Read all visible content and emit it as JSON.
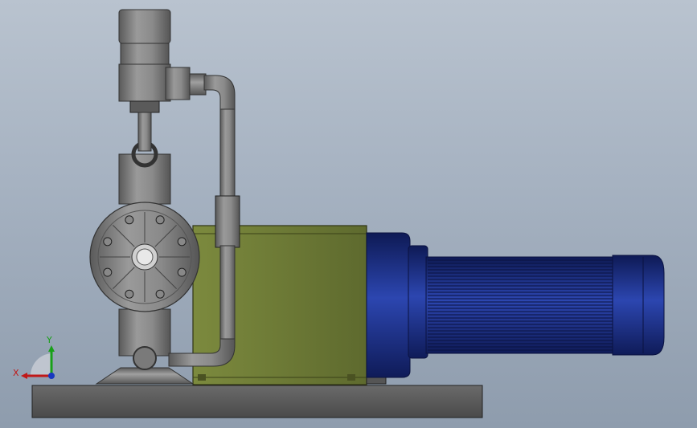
{
  "viewport": {
    "background_top": "#b9c3cf",
    "background_bottom": "#8e9cad"
  },
  "colors": {
    "pump_metal": "#7d7d7d",
    "pump_dark": "#4a4a4a",
    "gearbox": "#6e7a3a",
    "gearbox_edge": "#2f3414",
    "motor": "#1f3690",
    "motor_dark": "#0e1a55",
    "base": "#585858"
  },
  "triad": {
    "x_label": "X",
    "y_label": "Y",
    "x_color": "#c01818",
    "y_color": "#18a018",
    "z_color": "#1838c0"
  },
  "icons": [
    "coordinate-triad-icon"
  ]
}
